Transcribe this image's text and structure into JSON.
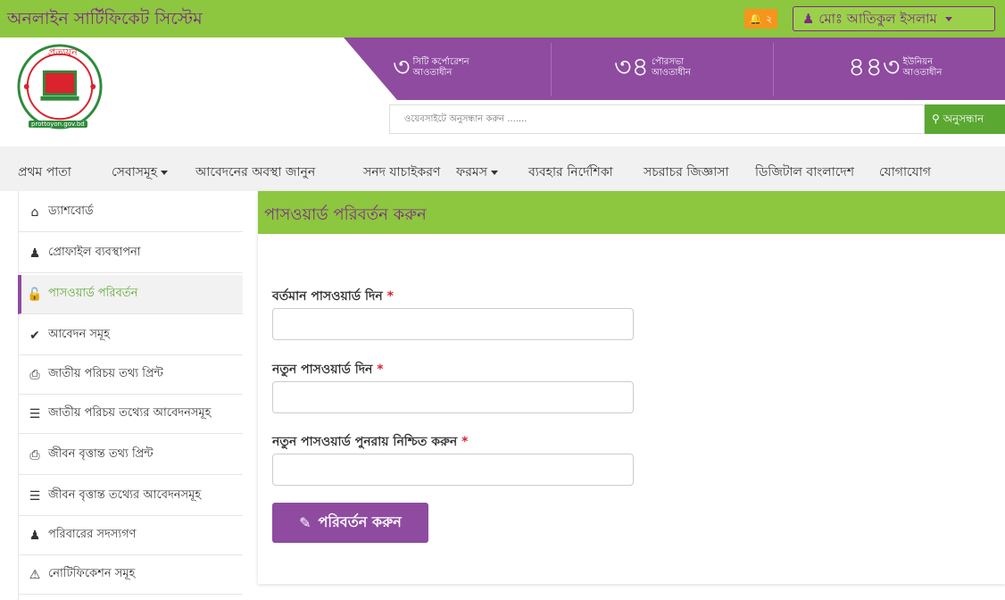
{
  "app": {
    "title": "অনলাইন সার্টিফিকেট সিস্টেম"
  },
  "topbar": {
    "notification_count": "২",
    "user_name": "মোঃ আতিকুল ইসলাম"
  },
  "header": {
    "logo_text": "প্রত্যয়ন",
    "logo_url": "prottoyon.gov.bd",
    "stats": [
      {
        "number": "৩",
        "line1": "সিটি কর্পোরেশন",
        "line2": "আওতাধীন"
      },
      {
        "number": "৩৪",
        "line1": "পৌরসভা",
        "line2": "আওতাধীন"
      },
      {
        "number": "৪৪৩",
        "line1": "ইউনিয়ন",
        "line2": "আওতাধীন"
      }
    ],
    "search_placeholder": "ওয়েবসাইটে অনুসন্ধান করুন .......",
    "search_button": "অনুসন্ধান"
  },
  "nav": {
    "items": [
      {
        "label": "প্রথম পাতা"
      },
      {
        "label": "সেবাসমূহ"
      },
      {
        "label": "আবেদনের অবস্থা জানুন"
      },
      {
        "label": "সনদ যাচাইকরণ"
      },
      {
        "label": "ফরমস"
      },
      {
        "label": "ব্যবহার নির্দেশিকা"
      },
      {
        "label": "সচরাচর জিজ্ঞাসা"
      },
      {
        "label": "ডিজিটাল বাংলাদেশ"
      },
      {
        "label": "যোগাযোগ"
      }
    ]
  },
  "sidebar": {
    "items": [
      {
        "label": "ড্যাশবোর্ড",
        "icon": "home-icon"
      },
      {
        "label": "প্রোফাইল ব্যবস্থাপনা",
        "icon": "user-icon"
      },
      {
        "label": "পাসওয়ার্ড পরিবর্তন",
        "icon": "unlock-icon"
      },
      {
        "label": "আবেদন সমূহ",
        "icon": "check-icon"
      },
      {
        "label": "জাতীয় পরিচয় তথ্য প্রিন্ট",
        "icon": "print-icon"
      },
      {
        "label": "জাতীয় পরিচয় তথ্যের আবেদনসমূহ",
        "icon": "list-icon"
      },
      {
        "label": "জীবন বৃত্তান্ত তথ্য প্রিন্ট",
        "icon": "print-icon"
      },
      {
        "label": "জীবন বৃত্তান্ত তথ্যের আবেদনসমূহ",
        "icon": "list-icon"
      },
      {
        "label": "পরিবারের সদস্যগণ",
        "icon": "user-icon"
      },
      {
        "label": "নোটিফিকেশন সমূহ",
        "icon": "warning-icon"
      }
    ]
  },
  "form": {
    "title": "পাসওয়ার্ড পরিবর্তন করুন",
    "current_label": "বর্তমান পাসওয়ার্ড দিন",
    "new_label": "নতুন পাসওয়ার্ড দিন",
    "confirm_label": "নতুন পাসওয়ার্ড পুনরায় নিশ্চিত করুন",
    "required_mark": "*",
    "submit_label": "পরিবর্তন করুন"
  },
  "colors": {
    "brand_green": "#8dc63f",
    "brand_purple": "#8e4ba0",
    "title_purple": "#7b2c84",
    "accent_orange": "#f7941d",
    "search_green": "#5aa832"
  }
}
